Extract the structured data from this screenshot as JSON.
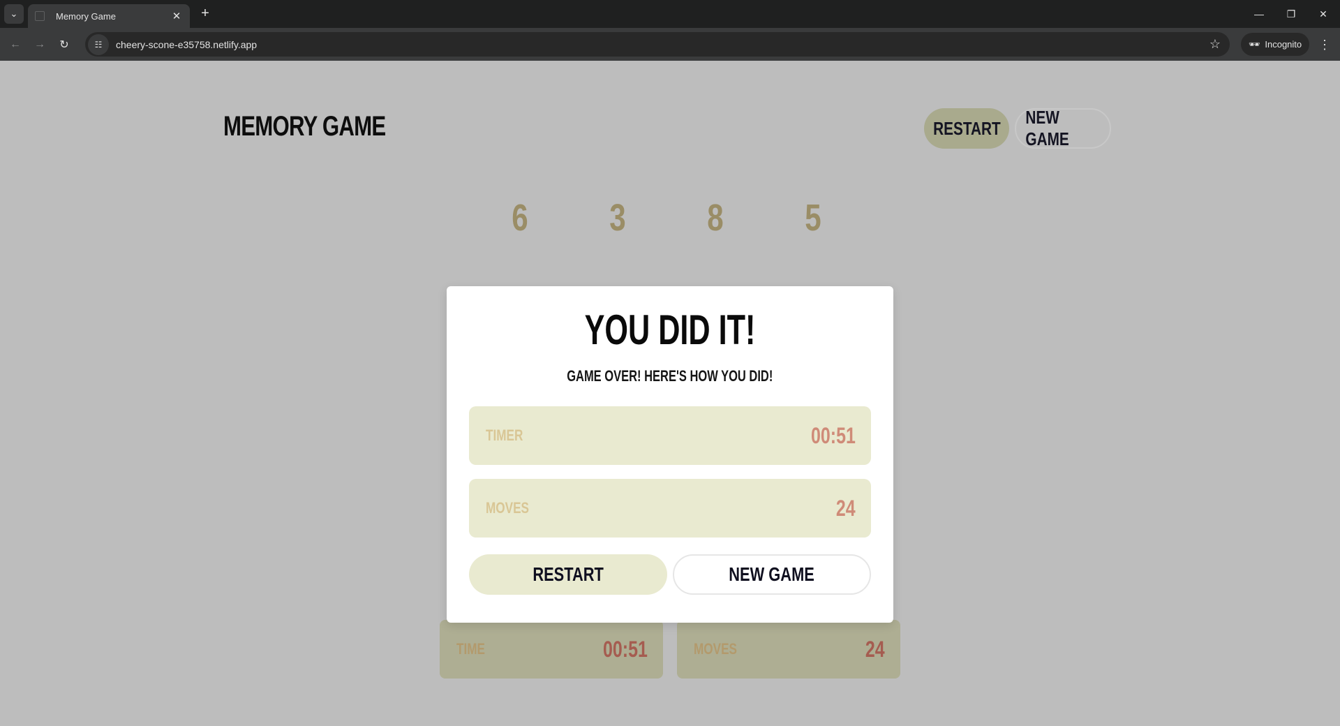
{
  "browser": {
    "tab_title": "Memory Game",
    "url": "cheery-scone-e35758.netlify.app",
    "incognito_label": "Incognito"
  },
  "header": {
    "logo": "MEMORY GAME",
    "restart_label": "RESTART",
    "new_game_label": "NEW GAME"
  },
  "board": {
    "visible_cards": [
      "6",
      "3",
      "8",
      "5"
    ]
  },
  "footer_stats": {
    "time_label": "TIME",
    "time_value": "00:51",
    "moves_label": "MOVES",
    "moves_value": "24"
  },
  "modal": {
    "title": "YOU DID IT!",
    "subtitle": "GAME OVER! HERE'S HOW YOU DID!",
    "timer_label": "TIMER",
    "timer_value": "00:51",
    "moves_label": "MOVES",
    "moves_value": "24",
    "restart_label": "RESTART",
    "new_game_label": "NEW GAME"
  },
  "colors": {
    "accent": "#e9ead0",
    "accent_dimmed": "#a9aa8d",
    "value_text": "#cf8b78",
    "label_text": "#d9c695"
  }
}
